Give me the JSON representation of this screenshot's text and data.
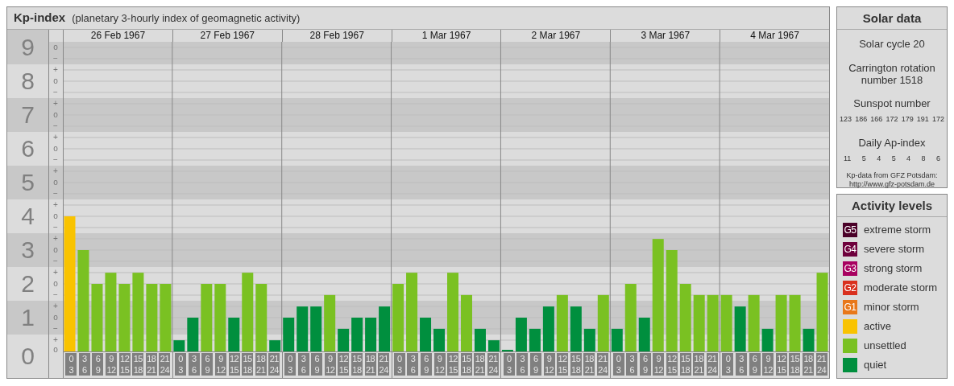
{
  "title": "Kp-index",
  "subtitle": "(planetary 3-hourly index of geomagnetic activity)",
  "sign_labels": [
    "o",
    "−",
    "+",
    "o",
    "−",
    "+",
    "o",
    "−",
    "+",
    "o",
    "−",
    "+",
    "o",
    "−",
    "+",
    "o",
    "−",
    "+",
    "o",
    "−",
    "+",
    "o",
    "−",
    "+",
    "o",
    "−",
    "+",
    "o"
  ],
  "dates": [
    "26 Feb 1967",
    "27 Feb 1967",
    "28 Feb 1967",
    "1 Mar 1967",
    "2 Mar 1967",
    "3 Mar 1967",
    "4 Mar 1967"
  ],
  "chart_data": {
    "type": "bar",
    "ylim": [
      0,
      9.1667
    ],
    "grid": true,
    "yticks": [
      9,
      8,
      7,
      6,
      5,
      4,
      3,
      2,
      1,
      0
    ],
    "categories": [
      "0\n3",
      "3\n6",
      "6\n9",
      "9\n12",
      "12\n15",
      "15\n18",
      "18\n21",
      "21\n24",
      "0\n3",
      "3\n6",
      "6\n9",
      "9\n12",
      "12\n15",
      "15\n18",
      "18\n21",
      "21\n24",
      "0\n3",
      "3\n6",
      "6\n9",
      "9\n12",
      "12\n15",
      "15\n18",
      "18\n21",
      "21\n24",
      "0\n3",
      "3\n6",
      "6\n9",
      "9\n12",
      "12\n15",
      "15\n18",
      "18\n21",
      "21\n24",
      "0\n3",
      "3\n6",
      "6\n9",
      "9\n12",
      "12\n15",
      "15\n18",
      "18\n21",
      "21\n24",
      "0\n3",
      "3\n6",
      "6\n9",
      "9\n12",
      "12\n15",
      "15\n18",
      "18\n21",
      "21\n24",
      "0\n3",
      "3\n6",
      "6\n9",
      "9\n12",
      "12\n15",
      "15\n18",
      "18\n21",
      "21\n24"
    ],
    "series": [
      {
        "name": "active",
        "color": "#f9c300",
        "values": [
          4,
          null,
          null,
          null,
          null,
          null,
          null,
          null,
          null,
          null,
          null,
          null,
          null,
          null,
          null,
          null,
          null,
          null,
          null,
          null,
          null,
          null,
          null,
          null,
          null,
          null,
          null,
          null,
          null,
          null,
          null,
          null,
          null,
          null,
          null,
          null,
          null,
          null,
          null,
          null,
          null,
          null,
          null,
          null,
          null,
          null,
          null,
          null,
          null,
          null,
          null,
          null,
          null,
          null,
          null,
          null
        ]
      },
      {
        "name": "unsettled",
        "color": "#7ac122",
        "values": [
          null,
          3,
          2,
          2.33,
          2,
          2.33,
          2,
          2,
          null,
          null,
          2,
          2,
          null,
          2.33,
          2,
          null,
          null,
          null,
          null,
          1.67,
          null,
          null,
          null,
          null,
          2,
          2.33,
          null,
          null,
          2.33,
          1.67,
          null,
          null,
          null,
          null,
          null,
          null,
          1.67,
          null,
          null,
          1.67,
          null,
          2,
          null,
          3.33,
          3,
          2,
          1.67,
          1.67,
          1.67,
          null,
          1.67,
          null,
          1.67,
          1.67,
          null,
          2.33
        ]
      },
      {
        "name": "quiet",
        "color": "#008f3e",
        "values": [
          null,
          null,
          null,
          null,
          null,
          null,
          null,
          null,
          0.33,
          1,
          null,
          null,
          1,
          null,
          null,
          0.33,
          1,
          1.33,
          1.33,
          null,
          0.67,
          1,
          1,
          1.33,
          null,
          null,
          1,
          0.67,
          null,
          null,
          0.67,
          0.33,
          0,
          1,
          0.67,
          1.33,
          null,
          1.33,
          0.67,
          null,
          0.67,
          null,
          1,
          null,
          null,
          null,
          null,
          null,
          null,
          1.33,
          null,
          0.67,
          null,
          null,
          0.67,
          null
        ]
      }
    ]
  },
  "solar": {
    "title": "Solar data",
    "cycle": "Solar cycle 20",
    "carrington": "Carrington rotation number 1518",
    "sunspot_label": "Sunspot number",
    "sunspots": [
      "123",
      "186",
      "166",
      "172",
      "179",
      "191",
      "172"
    ],
    "ap_label": "Daily Ap-index",
    "ap": [
      "11",
      "5",
      "4",
      "5",
      "4",
      "8",
      "6"
    ],
    "source": "Kp-data from GFZ Potsdam:\nhttp://www.gfz-potsdam.de"
  },
  "legend": {
    "title": "Activity levels",
    "items": [
      {
        "badge": "G5",
        "label": "extreme storm",
        "color": "#4a0028"
      },
      {
        "badge": "G4",
        "label": "severe storm",
        "color": "#6e003c"
      },
      {
        "badge": "G3",
        "label": "strong storm",
        "color": "#a80060"
      },
      {
        "badge": "G2",
        "label": "moderate storm",
        "color": "#d9301e"
      },
      {
        "badge": "G1",
        "label": "minor storm",
        "color": "#e8781a"
      }
    ]
  }
}
